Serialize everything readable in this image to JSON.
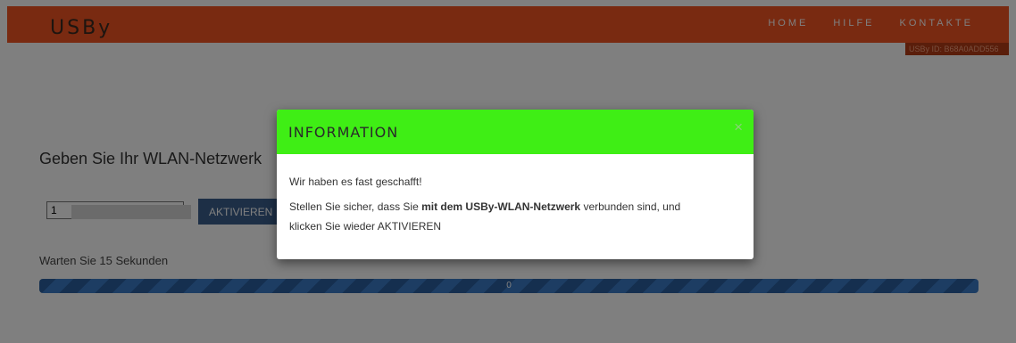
{
  "navbar": {
    "brand": "USBy",
    "links": [
      "HOME",
      "HILFE",
      "KONTAKTE"
    ],
    "color": "#f25522"
  },
  "device_badge": "USBy ID: B68A0ADD556",
  "main": {
    "prompt": "Geben Sie Ihr WLAN-Netzwerk",
    "ssid_value": "1",
    "activate_label": "AKTIVIEREN",
    "wait_label": "Warten Sie 15 Sekunden",
    "progress_text": "0"
  },
  "modal": {
    "title": "INFORMATION",
    "close": "×",
    "header_color": "#3fee15",
    "line1": "Wir haben es fast geschafft!",
    "line2_pre": "Stellen Sie sicher, dass Sie ",
    "line2_bold": "mit dem USBy-WLAN-Netzwerk",
    "line2_post": " verbunden sind, und",
    "line3": "klicken Sie wieder AKTIVIEREN"
  }
}
